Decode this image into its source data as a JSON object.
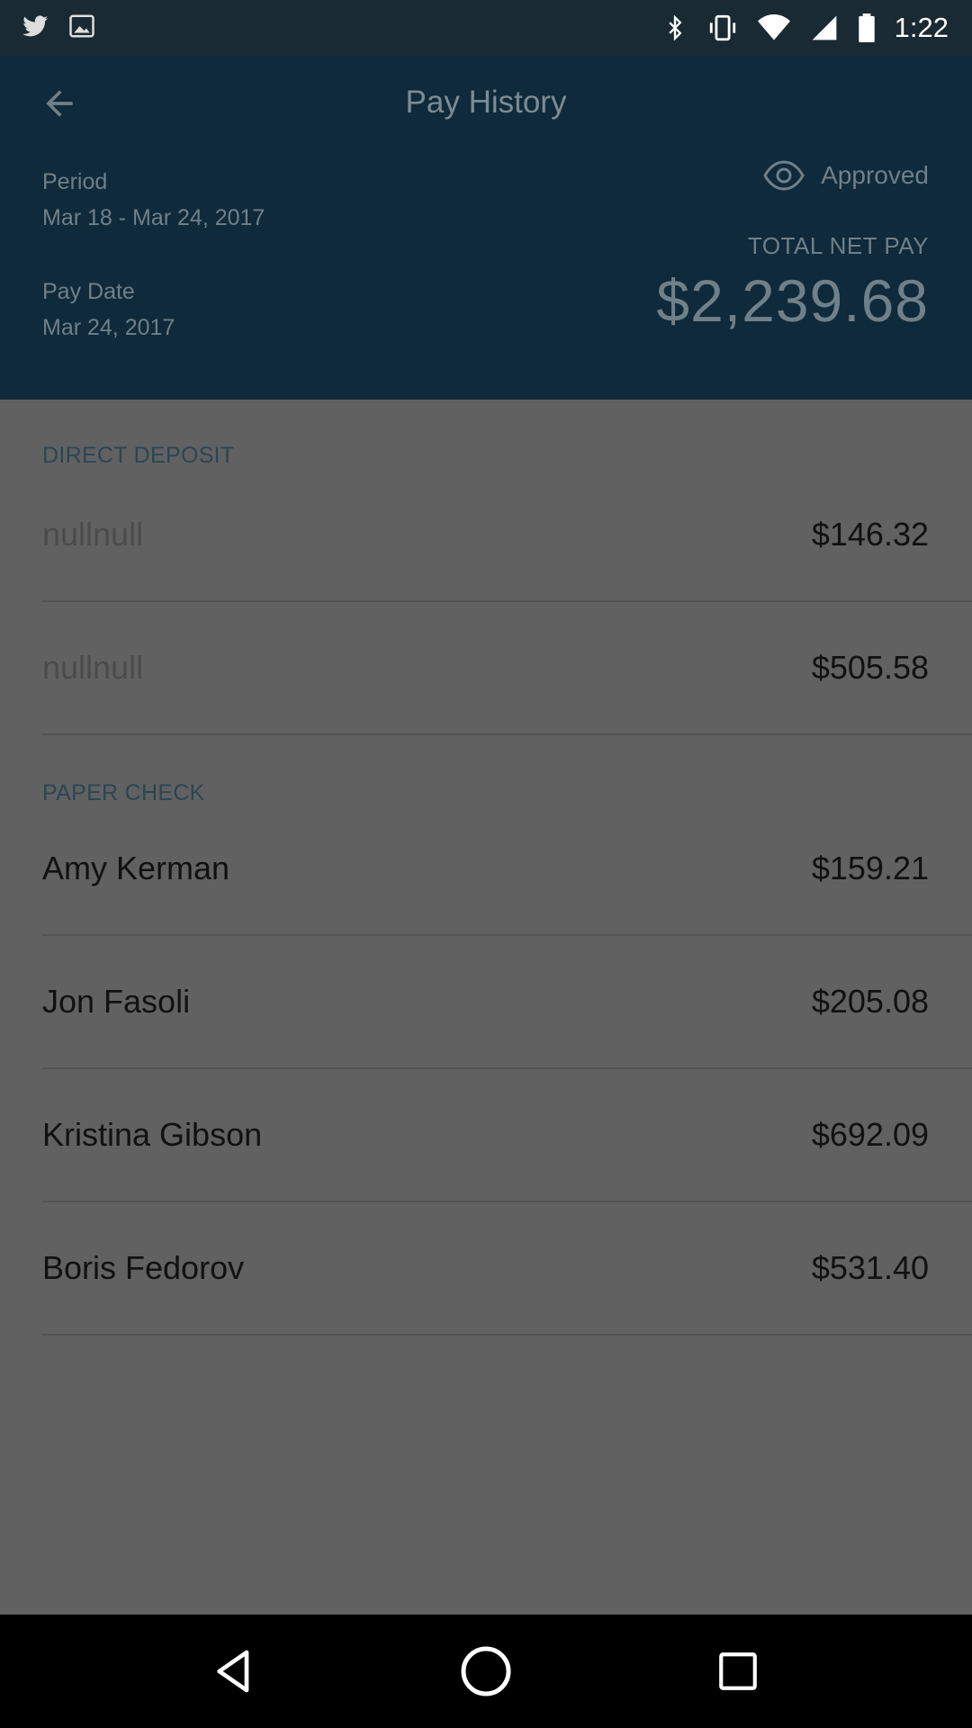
{
  "status_bar": {
    "time": "1:22",
    "icons": [
      "twitter-icon",
      "image-icon",
      "bluetooth-icon",
      "vibrate-icon",
      "wifi-icon",
      "signal-icon",
      "battery-icon"
    ]
  },
  "header": {
    "title": "Pay History",
    "back_icon": "arrow-left-icon",
    "period_label": "Period",
    "period_value": "Mar 18 - Mar 24, 2017",
    "pay_date_label": "Pay Date",
    "pay_date_value": "Mar 24, 2017",
    "status_icon": "eye-icon",
    "status_text": "Approved",
    "net_pay_label": "TOTAL NET PAY",
    "net_pay_amount": "$2,239.68"
  },
  "sections": {
    "direct_deposit": {
      "title": "DIRECT DEPOSIT",
      "rows": [
        {
          "name": "nullnull",
          "amount": "$146.32"
        },
        {
          "name": "nullnull",
          "amount": "$505.58"
        }
      ]
    },
    "paper_check": {
      "title": "PAPER CHECK",
      "rows": [
        {
          "name": "Amy Kerman",
          "amount": "$159.21"
        },
        {
          "name": "Jon Fasoli",
          "amount": "$205.08"
        },
        {
          "name": "Kristina Gibson",
          "amount": "$692.09"
        },
        {
          "name": "Boris Fedorov",
          "amount": "$531.40"
        }
      ]
    }
  },
  "nav_bar": {
    "icons": [
      "back-triangle-icon",
      "home-circle-icon",
      "recents-square-icon"
    ]
  },
  "colors": {
    "header_bg": "#0f2a3a",
    "content_bg": "#616161",
    "section_title": "#2a4655"
  }
}
